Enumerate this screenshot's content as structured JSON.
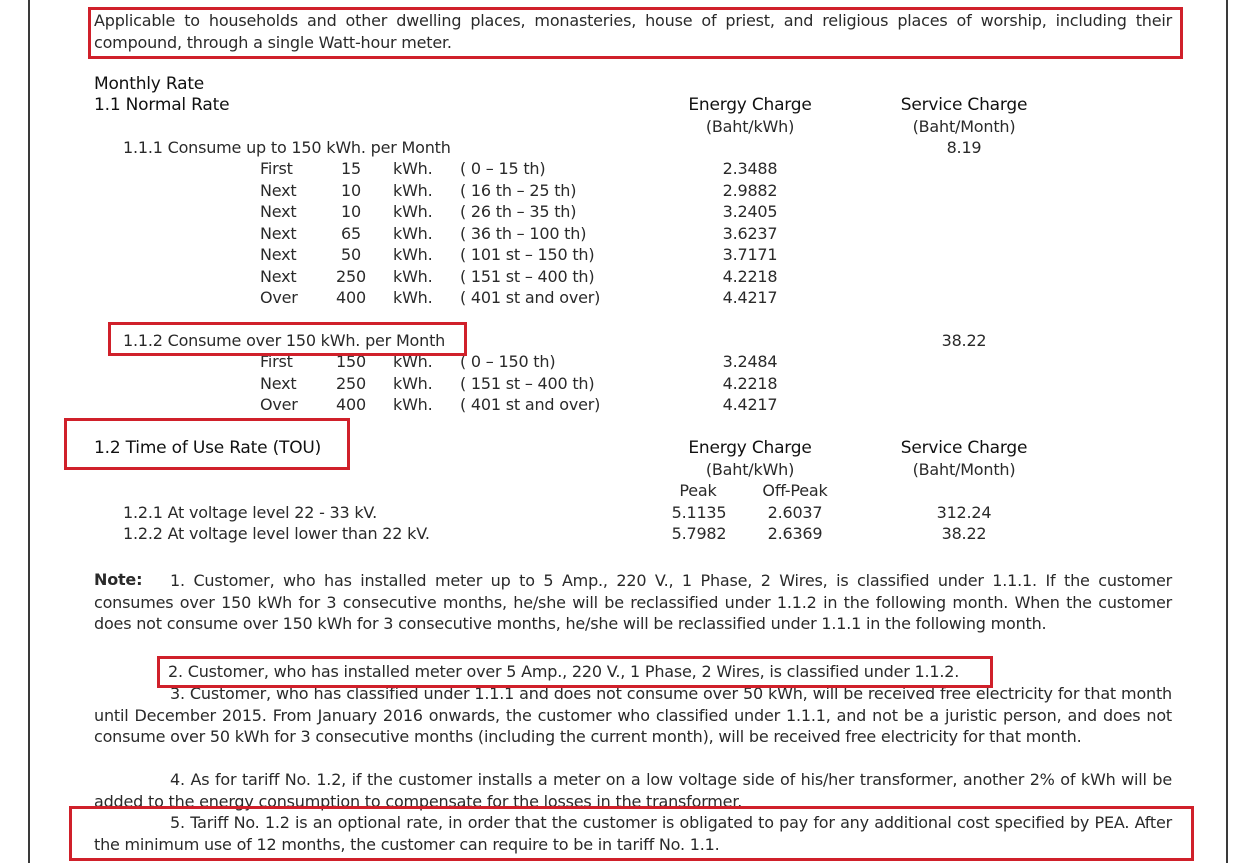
{
  "intro": "Applicable to households and other dwelling places, monasteries, house of priest, and religious places of worship, including their compound, through a single Watt-hour meter.",
  "monthly_rate": "Monthly Rate",
  "normal": {
    "title": "1.1 Normal Rate",
    "energy_header": "Energy Charge",
    "energy_unit": "(Baht/kWh)",
    "service_header": "Service Charge",
    "service_unit": "(Baht/Month)",
    "sub1": {
      "label": "1.1.1 Consume up to 150 kWh. per Month",
      "service": "8.19",
      "rows": [
        {
          "tier": "First",
          "qty": "15",
          "unit": "kWh.",
          "range": "( 0 – 15 th)",
          "rate": "2.3488"
        },
        {
          "tier": "Next",
          "qty": "10",
          "unit": "kWh.",
          "range": "( 16 th – 25 th)",
          "rate": "2.9882"
        },
        {
          "tier": "Next",
          "qty": "10",
          "unit": "kWh.",
          "range": "( 26 th – 35 th)",
          "rate": "3.2405"
        },
        {
          "tier": "Next",
          "qty": "65",
          "unit": "kWh.",
          "range": "( 36 th – 100 th)",
          "rate": "3.6237"
        },
        {
          "tier": "Next",
          "qty": "50",
          "unit": "kWh.",
          "range": "( 101 st – 150 th)",
          "rate": "3.7171"
        },
        {
          "tier": "Next",
          "qty": "250",
          "unit": "kWh.",
          "range": "( 151 st – 400 th)",
          "rate": "4.2218"
        },
        {
          "tier": "Over",
          "qty": "400",
          "unit": "kWh.",
          "range": "( 401 st and over)",
          "rate": "4.4217"
        }
      ]
    },
    "sub2": {
      "label": "1.1.2 Consume over 150 kWh. per Month",
      "service": "38.22",
      "rows": [
        {
          "tier": "First",
          "qty": "150",
          "unit": "kWh.",
          "range": "( 0 – 150 th)",
          "rate": "3.2484"
        },
        {
          "tier": "Next",
          "qty": "250",
          "unit": "kWh.",
          "range": "( 151 st – 400 th)",
          "rate": "4.2218"
        },
        {
          "tier": "Over",
          "qty": "400",
          "unit": "kWh.",
          "range": "( 401 st and over)",
          "rate": "4.4217"
        }
      ]
    }
  },
  "tou": {
    "title": "1.2 Time of Use Rate (TOU)",
    "energy_header": "Energy Charge",
    "energy_unit": "(Baht/kWh)",
    "service_header": "Service Charge",
    "service_unit": "(Baht/Month)",
    "peak": "Peak",
    "offpeak": "Off-Peak",
    "rows": [
      {
        "label": "1.2.1 At voltage level 22 - 33 kV.",
        "peak": "5.1135",
        "offpeak": "2.6037",
        "service": "312.24"
      },
      {
        "label": "1.2.2 At voltage level lower than 22 kV.",
        "peak": "5.7982",
        "offpeak": "2.6369",
        "service": "38.22"
      }
    ]
  },
  "notes": {
    "label": "Note:",
    "n1": "1. Customer, who has installed meter up to 5 Amp., 220 V., 1 Phase, 2 Wires, is classified under 1.1.1. If the customer consumes over 150 kWh for 3 consecutive months, he/she will be reclassified under 1.1.2 in the following month. When the customer does not consume over 150 kWh for 3 consecutive months, he/she will be reclassified under 1.1.1 in the following month.",
    "n2": "2. Customer, who has installed meter over 5 Amp., 220 V., 1 Phase, 2 Wires, is classified under 1.1.2.",
    "n3": "3. Customer, who has classified under 1.1.1 and does not consume over 50 kWh, will be received free electricity for that month until December 2015. From January 2016 onwards, the customer who classified under 1.1.1, and not be a juristic person, and does not consume over 50 kWh for 3 consecutive months (including the current month), will be received free electricity for that month.",
    "n4": "4. As for tariff No. 1.2, if the customer installs a meter on a low voltage side of his/her transformer, another 2% of kWh will be added to the energy consumption to compensate for the losses in the transformer.",
    "n5": "5. Tariff No. 1.2 is an optional rate, in order that the customer is obligated to pay for any additional cost specified by PEA. After the minimum use of 12 months, the customer can require to be in tariff No. 1.1."
  },
  "colors": {
    "highlight": "#d0202a",
    "text": "#2a2a2a"
  }
}
